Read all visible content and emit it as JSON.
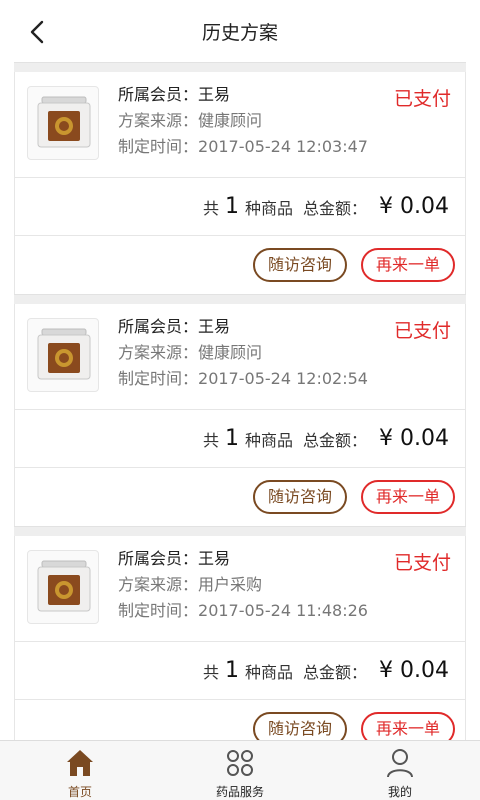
{
  "header": {
    "title": "历史方案"
  },
  "orders": [
    {
      "member_label": "所属会员：",
      "member": "王易",
      "source_label": "方案来源：",
      "source": "健康顾问",
      "time_label": "制定时间：",
      "time": "2017-05-24 12:03:47",
      "status": "已支付",
      "count_prefix": "共",
      "count": "1",
      "count_suffix": "种商品",
      "total_label": "总金额：",
      "price": "¥  0.04",
      "consult_label": "随访咨询",
      "reorder_label": "再来一单"
    },
    {
      "member_label": "所属会员：",
      "member": "王易",
      "source_label": "方案来源：",
      "source": "健康顾问",
      "time_label": "制定时间：",
      "time": "2017-05-24 12:02:54",
      "status": "已支付",
      "count_prefix": "共",
      "count": "1",
      "count_suffix": "种商品",
      "total_label": "总金额：",
      "price": "¥  0.04",
      "consult_label": "随访咨询",
      "reorder_label": "再来一单"
    },
    {
      "member_label": "所属会员：",
      "member": "王易",
      "source_label": "方案来源：",
      "source": "用户采购",
      "time_label": "制定时间：",
      "time": "2017-05-24 11:48:26",
      "status": "已支付",
      "count_prefix": "共",
      "count": "1",
      "count_suffix": "种商品",
      "total_label": "总金额：",
      "price": "¥  0.04",
      "consult_label": "随访咨询",
      "reorder_label": "再来一单"
    }
  ],
  "tabs": [
    {
      "label": "首页",
      "icon": "home-icon",
      "active": true
    },
    {
      "label": "药品服务",
      "icon": "grid-icon",
      "active": false
    },
    {
      "label": "我的",
      "icon": "user-icon",
      "active": false
    }
  ],
  "colors": {
    "accent": "#7a4a22",
    "status": "#e02a2a"
  }
}
